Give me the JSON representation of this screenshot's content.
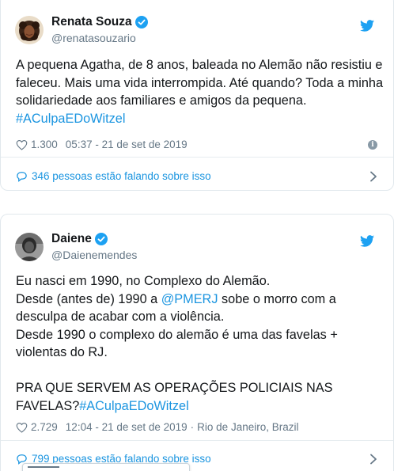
{
  "tweets": [
    {
      "author": {
        "name": "Renata Souza",
        "handle": "@renatasouzario"
      },
      "body_lines": [
        "A pequena Agatha, de 8 anos, baleada no Alemão não resistiu e",
        "faleceu. Mais uma vida interrompida. Até quando? Toda a minha",
        "solidariedade aos familiares e amigos da pequena."
      ],
      "hashtag_line": "#ACulpaEDoWitzel",
      "likes": "1.300",
      "timestamp": "05:37 - 21 de set de 2019",
      "talking": "346 pessoas estão falando sobre isso"
    },
    {
      "author": {
        "name": "Daiene",
        "handle": "@Daienemendes"
      },
      "body": {
        "l1": "Eu nasci em 1990, no Complexo do Alemão.",
        "l2_pre": "Desde (antes de) 1990 a ",
        "l2_mention": "@PMERJ",
        "l2_post": " sobe o morro com a",
        "l3": "desculpa de acabar com a violência.",
        "l4": "Desde 1990 o complexo do alemão é uma das favelas +",
        "l5": "violentas do RJ.",
        "l6": "PRA QUE SERVEM AS OPERAÇÕES POLICIAIS NAS",
        "l7_pre": "FAVELAS?",
        "l7_hashtag": "#ACulpaEDoWitzel"
      },
      "likes": "2.729",
      "timestamp": "12:04 - 21 de set de 2019",
      "separator": "·",
      "location": "Rio de Janeiro, Brazil",
      "talking": "799 pessoas estão falando sobre isso"
    }
  ],
  "colors": {
    "link": "#1b95e0",
    "secondary": "#657786",
    "verified": "#1da1f2",
    "text": "#14171a"
  },
  "icons": [
    "verified-badge-icon",
    "twitter-bird-icon",
    "heart-icon",
    "info-icon",
    "speech-bubble-icon",
    "chevron-right-icon"
  ]
}
